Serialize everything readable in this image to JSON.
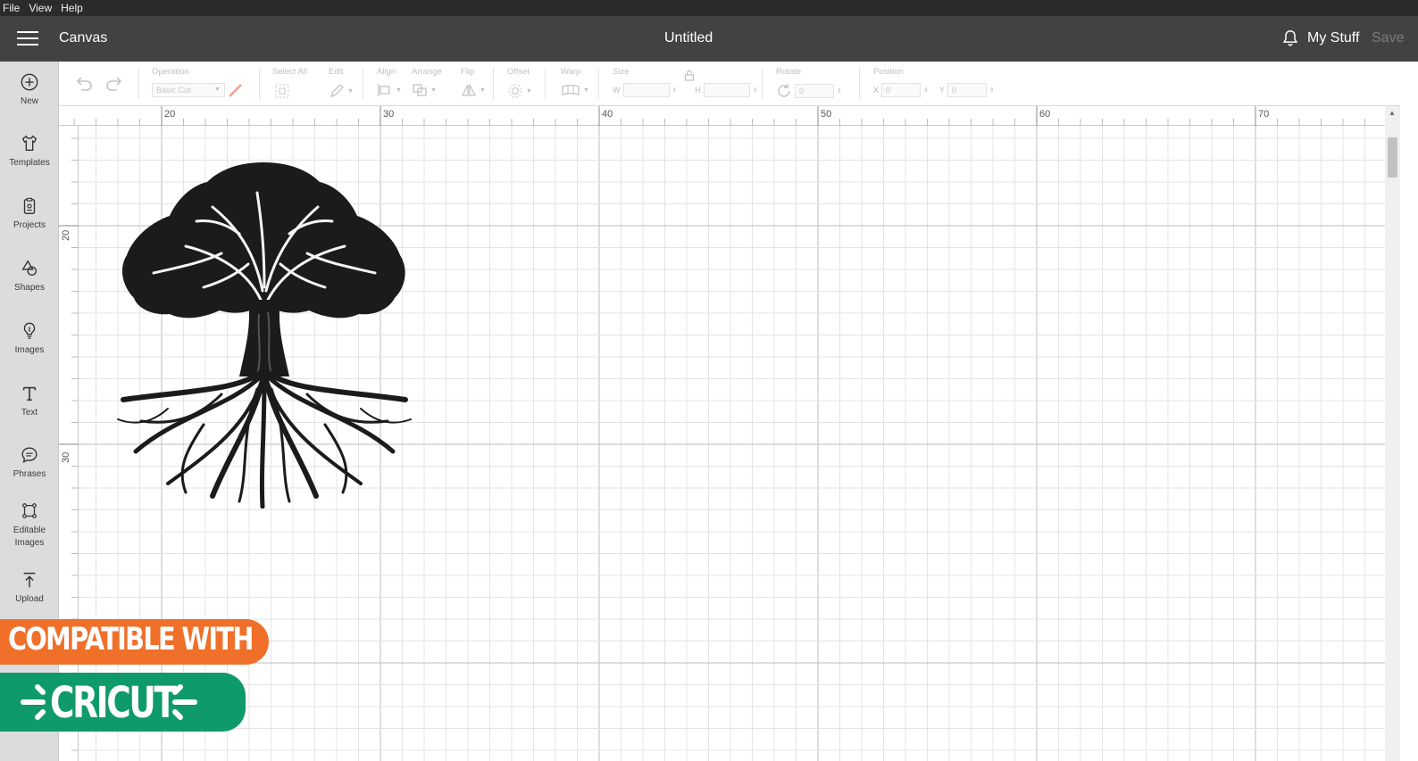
{
  "menubar": {
    "file": "File",
    "view": "View",
    "help": "Help"
  },
  "header": {
    "app_title": "Canvas",
    "doc_title": "Untitled",
    "my_stuff": "My Stuff",
    "save": "Save"
  },
  "sidebar": {
    "items": [
      {
        "label": "New",
        "icon": "plus-circle-icon"
      },
      {
        "label": "Templates",
        "icon": "shirt-icon"
      },
      {
        "label": "Projects",
        "icon": "clipboard-icon"
      },
      {
        "label": "Shapes",
        "icon": "shapes-icon"
      },
      {
        "label": "Images",
        "icon": "lightbulb-icon"
      },
      {
        "label": "Text",
        "icon": "text-icon"
      },
      {
        "label": "Phrases",
        "icon": "speech-bubble-icon"
      },
      {
        "label": "Editable",
        "label2": "Images",
        "icon": "editable-image-icon"
      },
      {
        "label": "Upload",
        "icon": "upload-icon"
      }
    ]
  },
  "toolbar": {
    "operation_label": "Operation",
    "operation_value": "Basic Cut",
    "select_all_label": "Select All",
    "edit_label": "Edit",
    "align_label": "Align",
    "arrange_label": "Arrange",
    "flip_label": "Flip",
    "offset_label": "Offset",
    "warp_label": "Warp",
    "size_label": "Size",
    "w_label": "W",
    "h_label": "H",
    "rotate_label": "Rotate",
    "rotate_value": "0",
    "position_label": "Position",
    "x_label": "X",
    "x_value": "0",
    "y_label": "Y",
    "y_value": "0"
  },
  "rulers": {
    "horizontal": [
      "20",
      "30",
      "40",
      "50",
      "60",
      "70"
    ],
    "vertical": [
      "20",
      "30"
    ]
  },
  "badge": {
    "line1": "COMPATIBLE WITH",
    "line2": "CRICUT",
    "colors": {
      "orange": "#f0702a",
      "green": "#0f9a69"
    }
  },
  "colors": {
    "header": "#414244",
    "menubar": "#2a2b2d",
    "sidebar": "#dcdcdc"
  }
}
